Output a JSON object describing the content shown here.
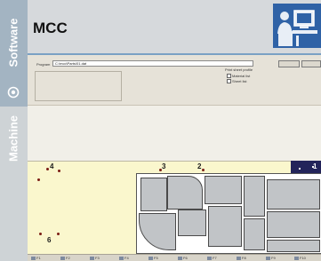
{
  "sidebar": {
    "top_label": "Software",
    "bottom_label": "Machine"
  },
  "header": {
    "title": "MCC",
    "logo_icon": "operator-at-computer-icon"
  },
  "colors": {
    "rail_top": "#a3b4c2",
    "rail_bottom": "#ced3d6",
    "banner": "#d6d9dc",
    "logo_bg": "#2f62a6",
    "sheet": "#faf7cd",
    "navy": "#23245a"
  },
  "app": {
    "program_label": "Program",
    "program_value": "C:\\mcc\\Parts\\01.dat",
    "options_label": "Print sheet profile",
    "options": [
      "Material list",
      "Sheet list"
    ]
  },
  "nesting": {
    "markers": [
      "4",
      "3",
      "2",
      "1",
      "6"
    ]
  },
  "toolbar": {
    "items": [
      "F1",
      "F2",
      "F3",
      "F4",
      "F5",
      "F6",
      "F7",
      "F8",
      "F9",
      "F10"
    ]
  }
}
